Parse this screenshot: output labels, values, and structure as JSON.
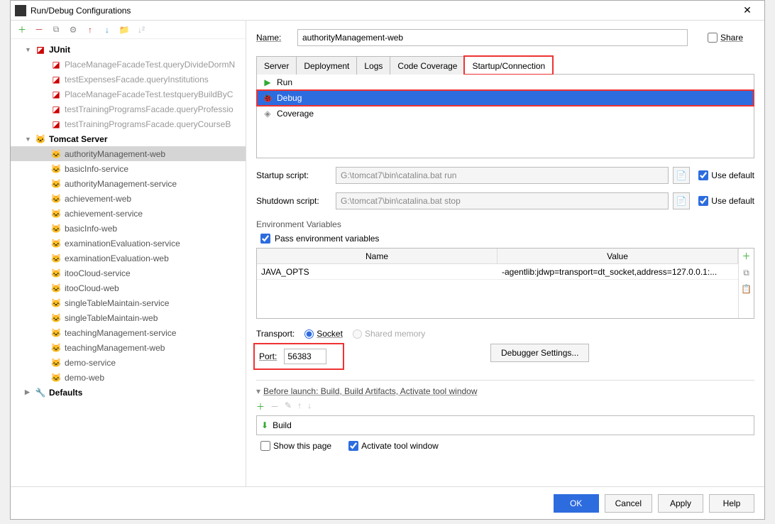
{
  "window": {
    "title": "Run/Debug Configurations"
  },
  "tree": {
    "junit": {
      "label": "JUnit",
      "items": [
        "PlaceManageFacadeTest.queryDivideDormN",
        "testExpensesFacade.queryInstitutions",
        "PlaceManageFacadeTest.testqueryBuildByC",
        "testTrainingProgramsFacade.queryProfessio",
        "testTrainingProgramsFacade.queryCourseB"
      ]
    },
    "tomcat": {
      "label": "Tomcat Server",
      "items": [
        "authorityManagement-web",
        "basicInfo-service",
        "authorityManagement-service",
        "achievement-web",
        "achievement-service",
        "basicInfo-web",
        "examinationEvaluation-service",
        "examinationEvaluation-web",
        "itooCloud-service",
        "itooCloud-web",
        "singleTableMaintain-service",
        "singleTableMaintain-web",
        "teachingManagement-service",
        "teachingManagement-web",
        "demo-service",
        "demo-web"
      ]
    },
    "defaults": {
      "label": "Defaults"
    }
  },
  "name": {
    "label": "Name:",
    "value": "authorityManagement-web"
  },
  "share": {
    "label": "Share"
  },
  "tabs": [
    "Server",
    "Deployment",
    "Logs",
    "Code Coverage",
    "Startup/Connection"
  ],
  "runlist": [
    "Run",
    "Debug",
    "Coverage"
  ],
  "startup": {
    "label": "Startup script:",
    "value": "G:\\tomcat7\\bin\\catalina.bat run",
    "use_default": "Use default"
  },
  "shutdown": {
    "label": "Shutdown script:",
    "value": "G:\\tomcat7\\bin\\catalina.bat stop",
    "use_default": "Use default"
  },
  "env": {
    "title": "Environment Variables",
    "pass": "Pass environment variables",
    "headers": {
      "name": "Name",
      "value": "Value"
    },
    "row": {
      "name": "JAVA_OPTS",
      "value": "-agentlib:jdwp=transport=dt_socket,address=127.0.0.1:..."
    }
  },
  "transport": {
    "label": "Transport:",
    "socket": "Socket",
    "shared": "Shared memory"
  },
  "port": {
    "label": "Port:",
    "value": "56383"
  },
  "debugger": {
    "label": "Debugger Settings..."
  },
  "before": {
    "title": "Before launch: Build, Build Artifacts, Activate tool window",
    "build": "Build",
    "show": "Show this page",
    "activate": "Activate tool window"
  },
  "footer": {
    "ok": "OK",
    "cancel": "Cancel",
    "apply": "Apply",
    "help": "Help"
  }
}
